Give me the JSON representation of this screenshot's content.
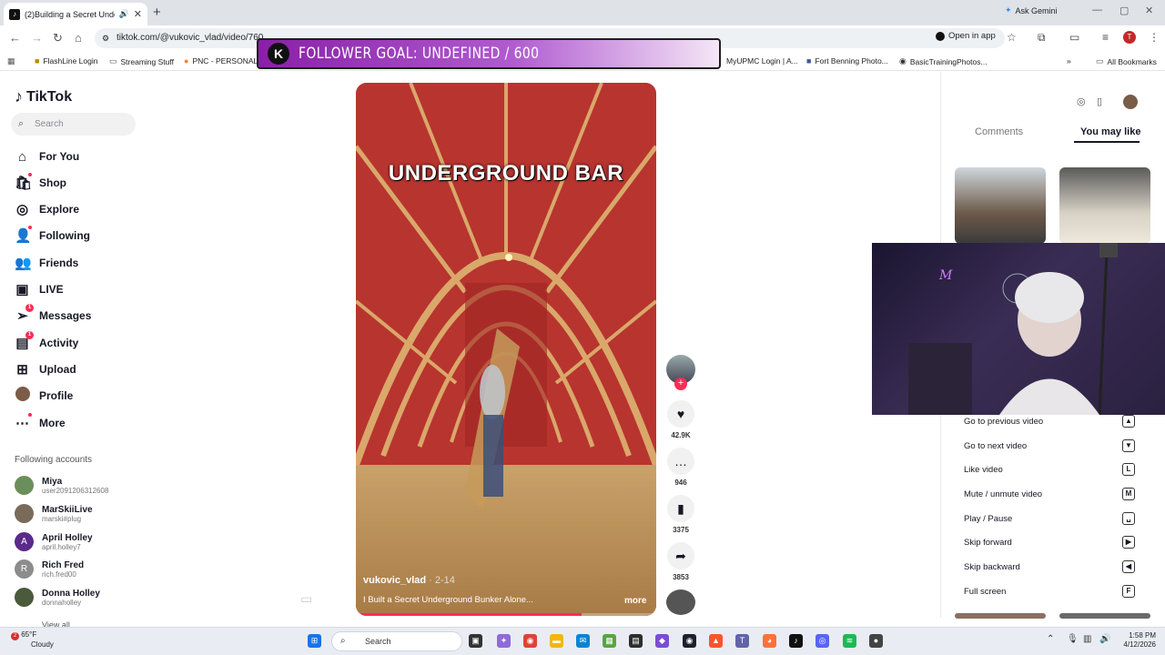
{
  "browser": {
    "tab_title": "(2)Building a Secret Undergr...",
    "url": "tiktok.com/@vukovic_vlad/video/760",
    "ask_gemini": "Ask Gemini",
    "open_in_app": "Open in app",
    "profile_initial": "T",
    "bookmarks": [
      "FlashLine Login",
      "Streaming Stuff",
      "PNC - PERSONAL",
      "MyUPMC Login | A...",
      "Fort Benning Photo...",
      "BasicTrainingPhotos..."
    ],
    "all_bookmarks": "All Bookmarks"
  },
  "overlay": {
    "logo_letter": "K",
    "goal_text": "FOLLOWER GOAL: UNDEFINED / 600"
  },
  "sidebar": {
    "brand": "TikTok",
    "search_placeholder": "Search",
    "nav": [
      {
        "label": "For You",
        "icon": "home-icon"
      },
      {
        "label": "Shop",
        "icon": "shop-icon"
      },
      {
        "label": "Explore",
        "icon": "compass-icon"
      },
      {
        "label": "Following",
        "icon": "following-icon"
      },
      {
        "label": "Friends",
        "icon": "friends-icon"
      },
      {
        "label": "LIVE",
        "icon": "live-icon"
      },
      {
        "label": "Messages",
        "icon": "messages-icon",
        "badge": "1"
      },
      {
        "label": "Activity",
        "icon": "activity-icon",
        "badge": "1"
      },
      {
        "label": "Upload",
        "icon": "upload-icon"
      },
      {
        "label": "Profile",
        "icon": "avatar"
      },
      {
        "label": "More",
        "icon": "more-icon"
      }
    ],
    "following_title": "Following accounts",
    "accounts": [
      {
        "name": "Miya",
        "handle": "user2091206312608",
        "initial": "",
        "color": "#6b8f5a"
      },
      {
        "name": "MarSkiiLive",
        "handle": "marski#plug",
        "initial": "",
        "color": "#7a6a5a"
      },
      {
        "name": "April Holley",
        "handle": "april.holley7",
        "initial": "A",
        "color": "#5b2a8a"
      },
      {
        "name": "Rich Fred",
        "handle": "rich.fred00",
        "initial": "R",
        "color": "#8c8c8c"
      },
      {
        "name": "Donna Holley",
        "handle": "donnaholley",
        "initial": "",
        "color": "#4a5a3a"
      }
    ],
    "view_all": "View all"
  },
  "video": {
    "overlay_title": "UNDERGROUND BAR",
    "author": "vukovic_vlad",
    "date": " · 2-14",
    "description": "I Built a Secret Underground Bunker Alone...",
    "more": "more",
    "progress": 0.75
  },
  "actions": {
    "likes": "42.9K",
    "comments": "946",
    "saves": "3375",
    "shares": "3853"
  },
  "right_panel": {
    "tab_comments": "Comments",
    "tab_you_may_like": "You may like"
  },
  "shortcuts": [
    {
      "label": "Go to previous video",
      "key": "▲"
    },
    {
      "label": "Go to next video",
      "key": "▼"
    },
    {
      "label": "Like video",
      "key": "L"
    },
    {
      "label": "Mute / unmute video",
      "key": "M"
    },
    {
      "label": "Play / Pause",
      "key": "␣"
    },
    {
      "label": "Skip forward",
      "key": "▶"
    },
    {
      "label": "Skip backward",
      "key": "◀"
    },
    {
      "label": "Full screen",
      "key": "F"
    }
  ],
  "taskbar": {
    "temp": "65°F",
    "condition": "Cloudy",
    "weather_badge": "2",
    "search": "Search",
    "time": "1:58 PM",
    "date": "4/12/2026"
  }
}
